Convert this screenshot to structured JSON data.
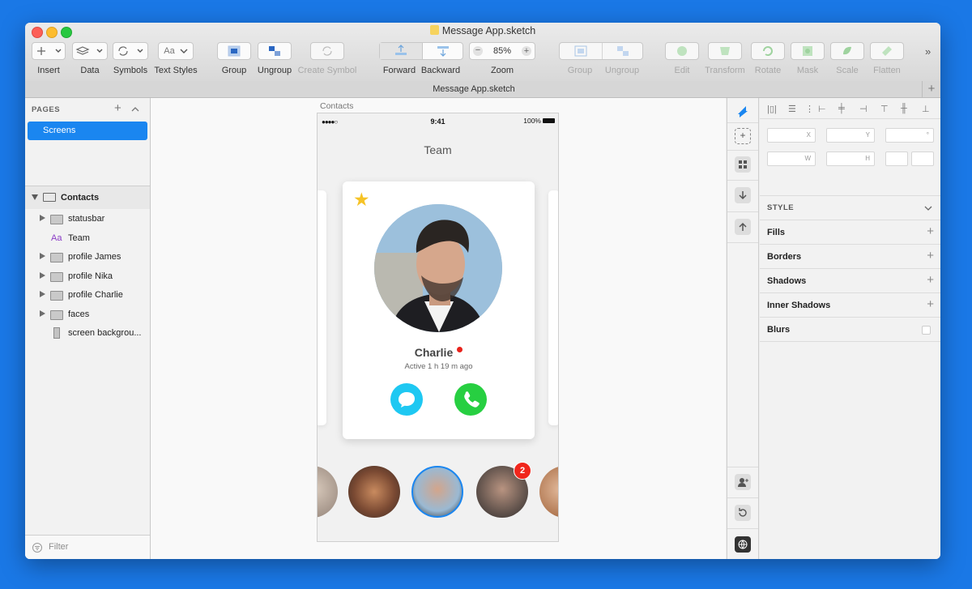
{
  "window": {
    "title": "Message App.sketch",
    "tab_title": "Message App.sketch"
  },
  "toolbar": {
    "insert": "Insert",
    "data": "Data",
    "symbols": "Symbols",
    "text_styles": "Text Styles",
    "text_styles_glyph": "Aa",
    "group": "Group",
    "ungroup": "Ungroup",
    "create_symbol": "Create Symbol",
    "forward": "Forward",
    "backward": "Backward",
    "zoom": "Zoom",
    "zoom_value": "85%",
    "group2": "Group",
    "ungroup2": "Ungroup",
    "edit": "Edit",
    "transform": "Transform",
    "rotate": "Rotate",
    "mask": "Mask",
    "scale": "Scale",
    "flatten": "Flatten"
  },
  "sidebar": {
    "pages_header": "PAGES",
    "page": "Screens",
    "artboard": "Contacts",
    "layers": [
      {
        "label": "statusbar",
        "kind": "group"
      },
      {
        "label": "Team",
        "kind": "text"
      },
      {
        "label": "profile James",
        "kind": "group"
      },
      {
        "label": "profile Nika",
        "kind": "group"
      },
      {
        "label": "profile Charlie",
        "kind": "group"
      },
      {
        "label": "faces",
        "kind": "group"
      },
      {
        "label": "screen backgrou...",
        "kind": "rect"
      }
    ],
    "text_layer_glyph": "Aa",
    "filter_placeholder": "Filter"
  },
  "canvas": {
    "artboard_title": "Contacts",
    "status_time": "9:41",
    "status_battery": "100%",
    "status_signal": "●●●●○",
    "header": "Team",
    "profile": {
      "name": "Charlie",
      "status": "Active 1 h 19 m ago"
    },
    "badge_count": "2"
  },
  "inspector": {
    "x_label": "X",
    "y_label": "Y",
    "angle_label": "°",
    "w_label": "W",
    "h_label": "H",
    "style_header": "STYLE",
    "sections": [
      "Fills",
      "Borders",
      "Shadows",
      "Inner Shadows",
      "Blurs"
    ]
  },
  "colors": {
    "accent": "#1a86f0",
    "message_button": "#1ec8f2",
    "call_button": "#27cf41",
    "star": "#f6c326",
    "badge": "#f0261c"
  }
}
